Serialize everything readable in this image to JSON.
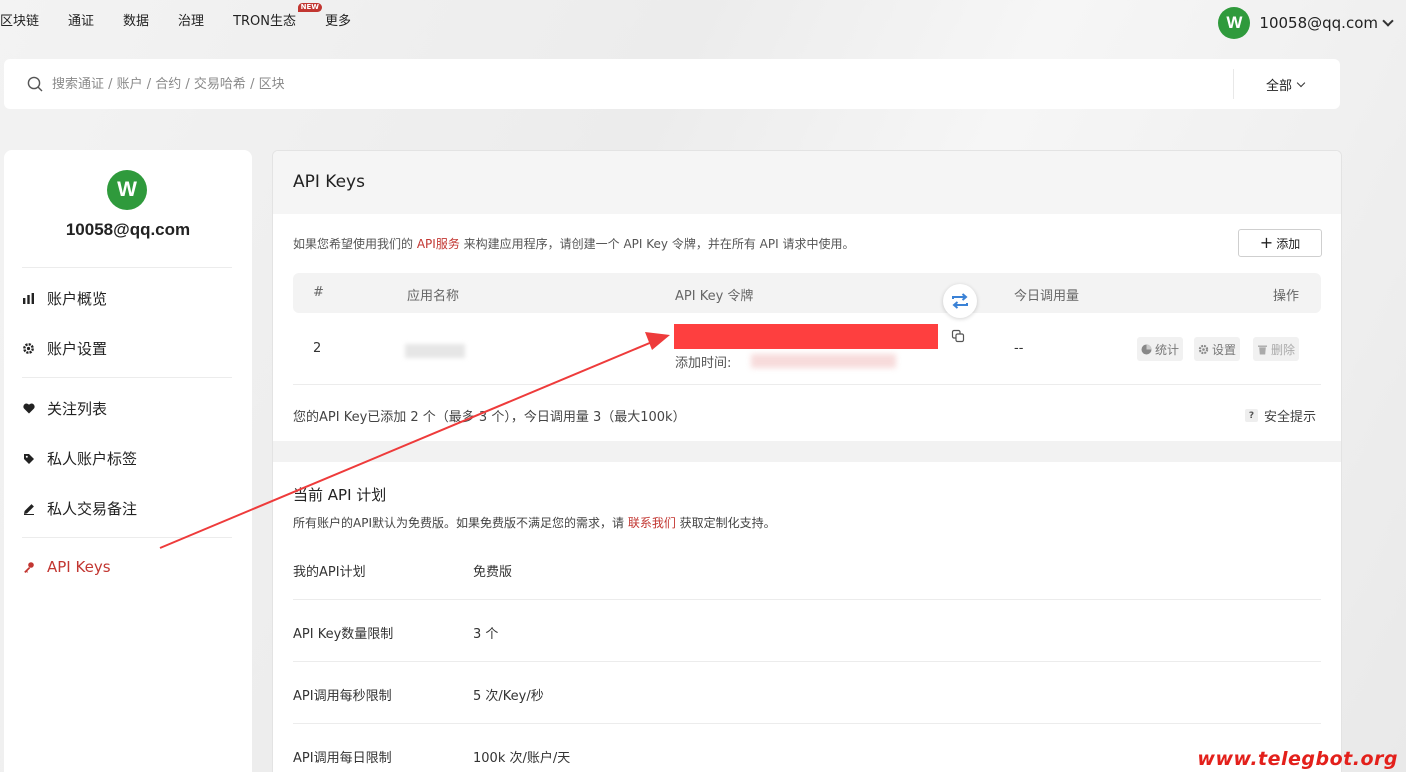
{
  "nav": {
    "items": [
      {
        "label": "区块链",
        "key": "blockchain"
      },
      {
        "label": "通证",
        "key": "tokens"
      },
      {
        "label": "数据",
        "key": "data"
      },
      {
        "label": "治理",
        "key": "governance"
      },
      {
        "label": "TRON生态",
        "key": "ecosystem",
        "badge": "NEW"
      },
      {
        "label": "更多",
        "key": "more"
      }
    ],
    "user": {
      "avatar_letter": "W",
      "email": "10058@qq.com"
    }
  },
  "search": {
    "placeholder": "搜索通证 / 账户 / 合约 / 交易哈希 / 区块",
    "filter_label": "全部"
  },
  "sidebar": {
    "avatar_letter": "W",
    "email": "10058@qq.com",
    "items": [
      {
        "label": "账户概览",
        "icon": "bar-chart-icon"
      },
      {
        "label": "账户设置",
        "icon": "gear-icon"
      },
      {
        "label": "关注列表",
        "icon": "heart-icon"
      },
      {
        "label": "私人账户标签",
        "icon": "tag-icon"
      },
      {
        "label": "私人交易备注",
        "icon": "pencil-icon"
      },
      {
        "label": "API Keys",
        "icon": "key-icon",
        "active": true
      }
    ]
  },
  "main": {
    "title": "API Keys",
    "intro_prefix": "如果您希望使用我们的 ",
    "intro_link": "API服务",
    "intro_suffix": " 来构建应用程序，请创建一个 API Key 令牌，并在所有 API 请求中使用。",
    "add_label": "添加",
    "table": {
      "headers": {
        "index": "#",
        "app_name": "应用名称",
        "api_key": "API Key 令牌",
        "today_calls": "今日调用量",
        "actions": "操作"
      },
      "rows": [
        {
          "index": "2",
          "added_time_label": "添加时间:",
          "today_calls": "--"
        }
      ],
      "actions": {
        "stats": "统计",
        "settings": "设置",
        "delete": "删除"
      }
    },
    "summary": "您的API Key已添加 2 个（最多 3 个），今日调用量 3（最大100k）",
    "security_tip": "安全提示"
  },
  "plan": {
    "title": "当前 API 计划",
    "desc_prefix": "所有账户的API默认为免费版。如果免费版不满足您的需求，请 ",
    "desc_link": "联系我们",
    "desc_suffix": " 获取定制化支持。",
    "rows": [
      {
        "key": "我的API计划",
        "value": "免费版"
      },
      {
        "key": "API Key数量限制",
        "value": "3 个"
      },
      {
        "key": "API调用每秒限制",
        "value": "5 次/Key/秒"
      },
      {
        "key": "API调用每日限制",
        "value": "100k 次/账户/天"
      }
    ]
  },
  "watermark": "www.telegbot.org",
  "colors": {
    "accent": "#c23631",
    "avatar": "#2f9a3c",
    "redaction": "#fe3f3f"
  }
}
